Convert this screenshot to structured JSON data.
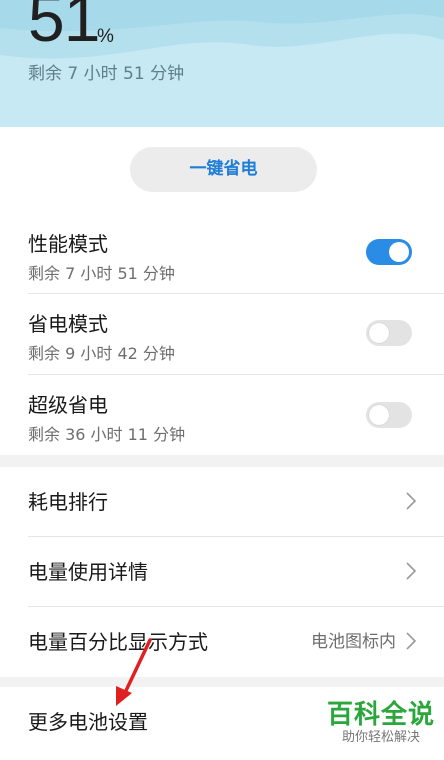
{
  "header": {
    "battery_percent": "51",
    "percent_unit": "%",
    "remaining": "剩余 7 小时 51 分钟"
  },
  "one_key_save": {
    "label": "一键省电"
  },
  "modes": [
    {
      "title": "性能模式",
      "remaining": "剩余 7 小时 51 分钟",
      "enabled": true
    },
    {
      "title": "省电模式",
      "remaining": "剩余 9 小时 42 分钟",
      "enabled": false
    },
    {
      "title": "超级省电",
      "remaining": "剩余 36 小时 11 分钟",
      "enabled": false
    }
  ],
  "settings": {
    "power_ranking": "耗电排行",
    "usage_details": "电量使用详情",
    "percent_display": "电量百分比显示方式",
    "percent_display_value": "电池图标内",
    "more_settings": "更多电池设置"
  },
  "watermark": {
    "main": "百科全说",
    "sub": "助你轻松解决"
  },
  "colors": {
    "accent": "#2b8ce6",
    "button_text": "#1f7ed6",
    "header_bg": "#c7e9f3",
    "watermark": "#2aa63b",
    "annotation_arrow": "#e02020"
  }
}
